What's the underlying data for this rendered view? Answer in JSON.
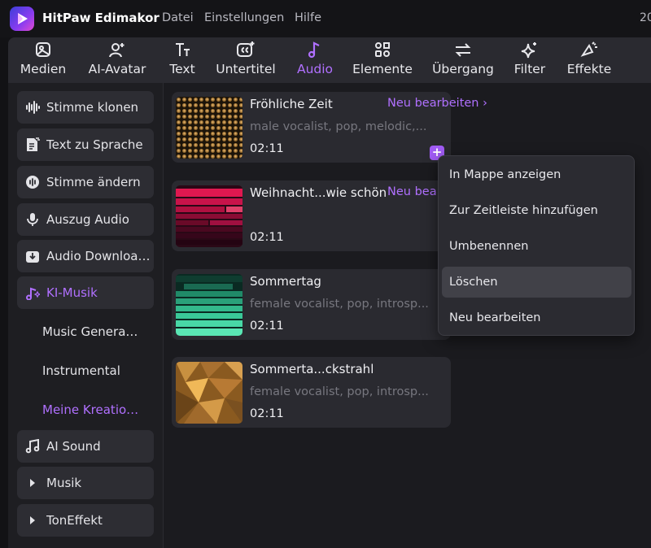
{
  "app": {
    "name": "HitPaw Edimakor",
    "edge_text": "20"
  },
  "menu": [
    "Datei",
    "Einstellungen",
    "Hilfe"
  ],
  "toolbar": [
    {
      "id": "medien",
      "label": "Medien",
      "icon": "media-icon"
    },
    {
      "id": "ai-avatar",
      "label": "AI-Avatar",
      "icon": "avatar-icon"
    },
    {
      "id": "text",
      "label": "Text",
      "icon": "text-icon"
    },
    {
      "id": "untertitel",
      "label": "Untertitel",
      "icon": "subtitle-icon"
    },
    {
      "id": "audio",
      "label": "Audio",
      "icon": "music-note-icon",
      "active": true
    },
    {
      "id": "elemente",
      "label": "Elemente",
      "icon": "elements-icon"
    },
    {
      "id": "uebergang",
      "label": "Übergang",
      "icon": "transition-icon"
    },
    {
      "id": "filter",
      "label": "Filter",
      "icon": "filter-sparkle-icon"
    },
    {
      "id": "effekte",
      "label": "Effekte",
      "icon": "effects-icon"
    }
  ],
  "sidebar": {
    "items": [
      {
        "label": "Stimme klonen",
        "icon": "waveform-icon"
      },
      {
        "label": "Text zu Sprache",
        "icon": "text-to-speech-icon"
      },
      {
        "label": "Stimme ändern",
        "icon": "voice-change-icon"
      },
      {
        "label": "Auszug Audio",
        "icon": "microphone-icon"
      },
      {
        "label": "Audio Downloa…",
        "icon": "download-icon"
      },
      {
        "label": "KI-Musik",
        "icon": "ai-music-icon",
        "active": true
      }
    ],
    "subitems": [
      {
        "label": "Music Genera…"
      },
      {
        "label": "Instrumental"
      },
      {
        "label": "Meine Kreatio…",
        "active": true
      }
    ],
    "lower_items": [
      {
        "label": "AI Sound",
        "icon": "music-notes-icon"
      },
      {
        "label": "Musik",
        "icon": "caret-right-icon"
      },
      {
        "label": "TonEffekt",
        "icon": "caret-right-icon"
      }
    ]
  },
  "tracks": [
    {
      "title": "Fröhliche Zeit",
      "desc": "male vocalist, pop, melodic,...",
      "duration": "02:11",
      "edit_label": "Neu bearbeiten  ›"
    },
    {
      "title": "Weihnacht...wie schön",
      "desc": "",
      "duration": "02:11",
      "edit_label": "Neu bea"
    },
    {
      "title": "Sommertag",
      "desc": "female vocalist, pop, introsp...",
      "duration": "02:11",
      "edit_label": ""
    },
    {
      "title": "Sommerta...ckstrahl",
      "desc": "female vocalist, pop, introsp...",
      "duration": "02:11",
      "edit_label": ""
    }
  ],
  "add_button": "+",
  "context_menu": [
    {
      "label": "In Mappe anzeigen"
    },
    {
      "label": "Zur Zeitleiste hinzufügen"
    },
    {
      "label": "Umbenennen"
    },
    {
      "label": "Löschen",
      "hover": true
    },
    {
      "label": "Neu bearbeiten"
    }
  ],
  "colors": {
    "accent": "#b070ff",
    "background": "#121215",
    "panel": "#2a2a30"
  }
}
